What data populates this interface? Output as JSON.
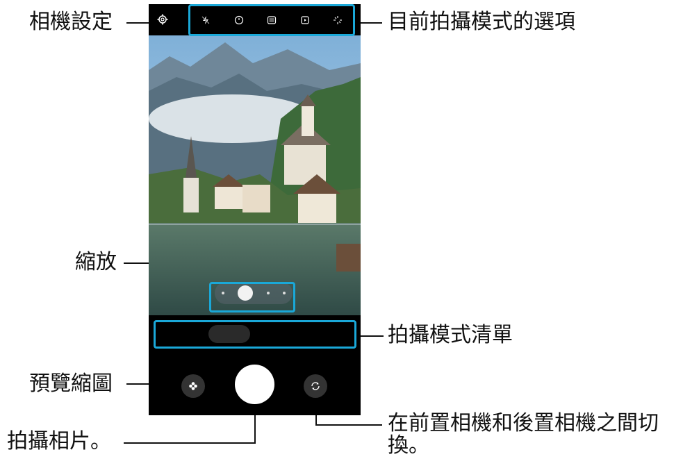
{
  "callouts": {
    "camera_settings": "相機設定",
    "shooting_options": "目前拍攝模式的選項",
    "zoom": "縮放",
    "mode_list": "拍攝模式清單",
    "preview_thumbnail": "預覽縮圖",
    "take_photo": "拍攝相片。",
    "switch_cameras_line1": "在前置相機和後置相機之間切",
    "switch_cameras_line2": "換。"
  },
  "icons": {
    "settings": "gear-icon",
    "options": [
      "flash-off-icon",
      "timer-icon",
      "aspect-ratio-icon",
      "motion-photo-icon",
      "filter-icon"
    ],
    "thumbnail": "flower-icon",
    "switch": "rotate-camera-icon"
  },
  "colors": {
    "callout_box": "#1aa8d8"
  }
}
